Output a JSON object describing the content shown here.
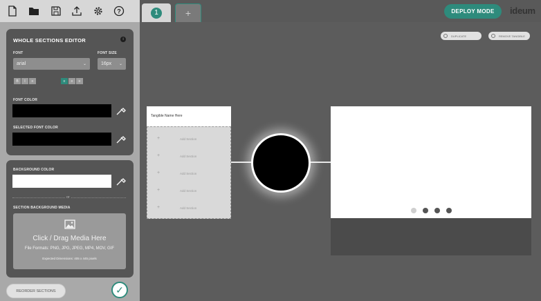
{
  "toolbar": {
    "icons": [
      "new-file-icon",
      "open-folder-icon",
      "save-icon",
      "upload-icon",
      "settings-icon",
      "help-icon"
    ]
  },
  "tabs": {
    "active_number": "1",
    "add_label": "+"
  },
  "header": {
    "deploy_label": "DEPLOY MODE",
    "brand": "ideum"
  },
  "editor": {
    "title": "WHOLE SECTIONS EDITOR",
    "font_label": "FONT",
    "font_value": "arial",
    "font_size_label": "FONT SIZE",
    "font_size_value": "16px",
    "style_buttons": [
      "B",
      "I",
      "≡"
    ],
    "font_color_label": "FONT COLOR",
    "font_color": "#000000",
    "selected_font_color_label": "SELECTED FONT COLOR",
    "selected_font_color": "#000000"
  },
  "background": {
    "label": "BACKGROUND COLOR",
    "color": "#ffffff",
    "or_label": "or",
    "media_label": "SECTION BACKGROUND MEDIA",
    "drop_title": "Click / Drag Media Here",
    "drop_formats": "File Formats: PNG, JPG, JPEG, MP4, MOV, GIF",
    "drop_dims": "Expected Dimensions: 405 x 445 pixels"
  },
  "footer": {
    "reorder_label": "REORDER SECTIONS"
  },
  "canvas": {
    "duplicate_label": "DUPLICATE",
    "remove_label": "REMOVE TANGIBLE",
    "tangible_name": "Tangible Name Here",
    "add_section_label": "Add Section",
    "preview_pages": 4,
    "active_page": 2
  },
  "colors": {
    "accent": "#2e8b7c",
    "canvas_bg": "#5c5c5c",
    "sidebar_bg": "#a9a9a9",
    "panel_bg": "#555555"
  }
}
